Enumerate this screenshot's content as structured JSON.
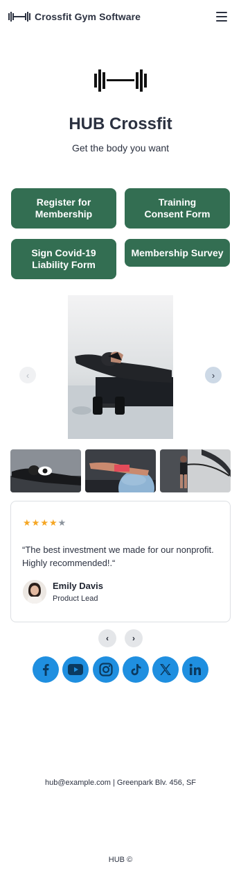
{
  "header": {
    "brand": "Crossfit Gym Software",
    "logo_icon": "barbell-icon",
    "menu_icon": "hamburger-menu-icon"
  },
  "hero": {
    "logo_icon": "barbell-icon",
    "title": "HUB Crossfit",
    "subtitle": "Get the body you want"
  },
  "buttons": [
    {
      "label": "Register for\nMembership"
    },
    {
      "label": "Training\nConsent Form"
    },
    {
      "label": "Sign Covid-19\nLiability Form"
    },
    {
      "label": "Membership Survey"
    }
  ],
  "gallery": {
    "prev_icon": "chevron-left-icon",
    "next_icon": "chevron-right-icon",
    "thumbnail_count": 3,
    "view_icon": "eye-icon"
  },
  "review": {
    "rating": 4,
    "rating_max": 5,
    "quote": "“The best investment we made for our nonprofit. Highly recommended!.“",
    "name": "Emily Davis",
    "role": "Product Lead",
    "prev_icon": "chevron-left-icon",
    "next_icon": "chevron-right-icon"
  },
  "social": [
    "facebook-icon",
    "youtube-icon",
    "instagram-icon",
    "tiktok-icon",
    "x-icon",
    "linkedin-icon"
  ],
  "footer": {
    "contact": "hub@example.com | Greenpark Blv. 456, SF",
    "copyright": "HUB ©"
  },
  "colors": {
    "primary_green": "#336e52",
    "social_blue": "#1f8fe0",
    "star_gold": "#f5a623",
    "text": "#2b3140"
  }
}
